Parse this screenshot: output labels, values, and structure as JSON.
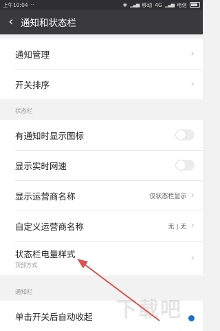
{
  "status_bar": {
    "time": "上午10:04",
    "network_carrier1": "移动",
    "network_type": "4G",
    "network_carrier2": "电信"
  },
  "header": {
    "back_icon": "chevron-left-icon",
    "title": "通知和状态栏"
  },
  "top_section": {
    "items": [
      {
        "label": "通知管理"
      },
      {
        "label": "开关排序"
      }
    ]
  },
  "status_section": {
    "header": "状态栏",
    "items": [
      {
        "label": "有通知时显示图标",
        "toggle": false
      },
      {
        "label": "显示实时网速",
        "toggle": false
      },
      {
        "label": "显示运营商名称",
        "value": "仅状态栏显示"
      },
      {
        "label": "自定义运营商名称",
        "value": "无 | 无"
      },
      {
        "label": "状态栏电量样式",
        "sub": "顶部方式"
      }
    ]
  },
  "notify_section": {
    "header": "通知栏",
    "items": [
      {
        "label": "单击开关后自动收起"
      }
    ]
  },
  "colors": {
    "title_bar": "#3a3a3e",
    "status_bar": "#2f2f33",
    "annotation_arrow": "#d9534f"
  },
  "watermark": "下载吧"
}
